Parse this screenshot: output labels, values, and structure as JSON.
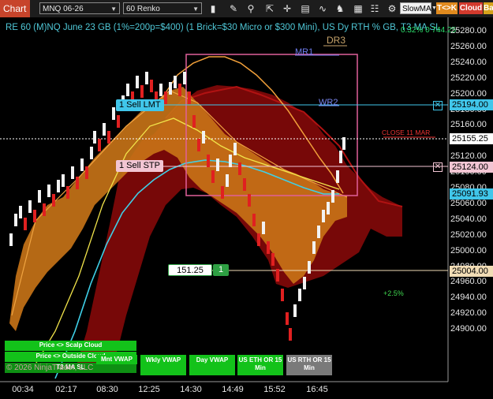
{
  "toolbar": {
    "chart_tab": "Chart",
    "instrument": "MNQ 06-26",
    "bar_type": "60 Renko",
    "indicator_select": "SlowMA",
    "btn_tck": "T<>K",
    "btn_cloud": "Cloud",
    "btn_ba": "Ba"
  },
  "header": {
    "title": "RE 60 (M)NQ June 23 GB (1%=200p=$400) (1 Brick=$30 Micro or $300 Mini), US Dy RTH % GB, T3 MA SL",
    "top_right": "0.32% 0 744.25"
  },
  "levels": {
    "dr3": "DR3",
    "mr1": "MR1",
    "wr2": "WR2",
    "close_label": "CLOSE 11 MAR",
    "pct_label": "+2.5%"
  },
  "orders": {
    "sell_lmt": "1 Sell LMT",
    "sell_stp": "1 Sell STP",
    "position_price": "151.25",
    "position_qty": "1"
  },
  "price_axis": {
    "ticks": [
      "25280.00",
      "25260.00",
      "25240.00",
      "25220.00",
      "25200.00",
      "25180.00",
      "25160.00",
      "25140.00",
      "25120.00",
      "25100.00",
      "25080.00",
      "25060.00",
      "25040.00",
      "25020.00",
      "25000.00",
      "24980.00",
      "24960.00",
      "24940.00",
      "24920.00",
      "24900.00"
    ],
    "sell_lmt_price": "25194.00",
    "current_price": "25155.25",
    "sell_stp_price": "25124.00",
    "cyan_price": "25091.93",
    "position_price": "25004.00"
  },
  "time_axis": [
    "00:34",
    "02:17",
    "08:30",
    "12:25",
    "14:30",
    "14:49",
    "15:52",
    "16:45"
  ],
  "buttons": {
    "price_scalp": "Price <> Scalp Cloud",
    "price_outside": "Price <> Outside Cloud",
    "t3_ma_sl": "T3 MA SL",
    "mnt_vwap": "Mnt VWAP",
    "wkly_vwap": "Wkly VWAP",
    "day_vwap": "Day VWAP",
    "us_eth": "US ETH OR 15 Min",
    "us_rth": "US RTH OR 15 Min"
  },
  "copyright": "© 2026 NinjaTrader, LLC",
  "colors": {
    "toolbar_bg": "#1d1d1d",
    "chart_tab": "#c7442b",
    "cyan": "#40c6ea",
    "green_btn": "#13c21a",
    "orange_cloud": "#d9891e",
    "red_cloud": "#8a0a0a",
    "pink_box": "#e0609a"
  }
}
